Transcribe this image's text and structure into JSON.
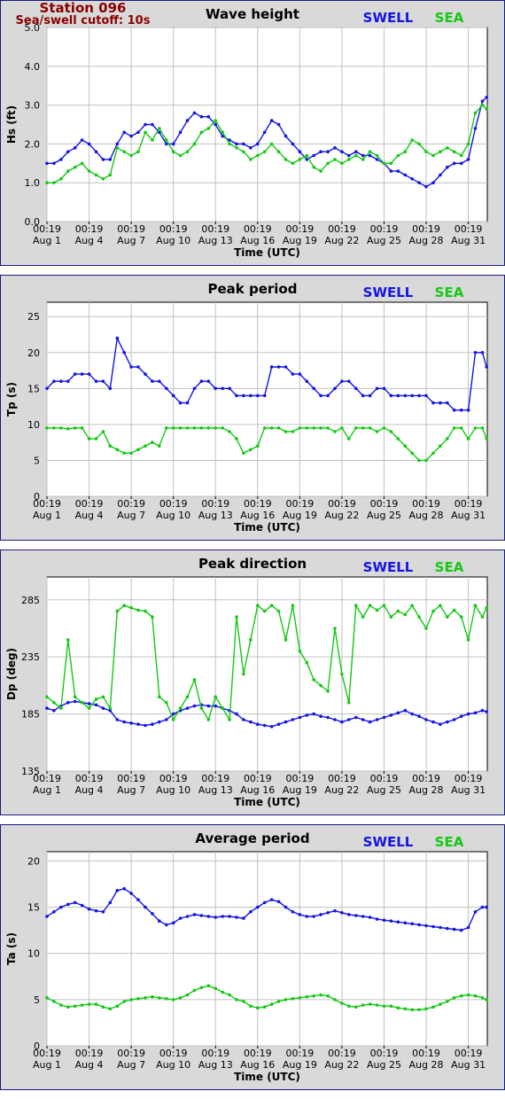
{
  "header": {
    "station": "Station 096",
    "cutoff": "Sea/swell cutoff: 10s"
  },
  "colors": {
    "swell": "#1414e6",
    "sea": "#14c814",
    "frame": "#1a1a80",
    "panel_bg": "#d9d9d9",
    "grid": "#c0c0c0"
  },
  "legend": {
    "swell": "SWELL",
    "sea": "SEA"
  },
  "x_axis": {
    "label": "Time (UTC)",
    "ticks": [
      {
        "day": 1,
        "time": "00:19",
        "date": "Aug 1"
      },
      {
        "day": 4,
        "time": "00:19",
        "date": "Aug 4"
      },
      {
        "day": 7,
        "time": "00:19",
        "date": "Aug 7"
      },
      {
        "day": 10,
        "time": "00:19",
        "date": "Aug 10"
      },
      {
        "day": 13,
        "time": "00:19",
        "date": "Aug 13"
      },
      {
        "day": 16,
        "time": "00:19",
        "date": "Aug 16"
      },
      {
        "day": 19,
        "time": "00:19",
        "date": "Aug 19"
      },
      {
        "day": 22,
        "time": "00:19",
        "date": "Aug 22"
      },
      {
        "day": 25,
        "time": "00:19",
        "date": "Aug 25"
      },
      {
        "day": 28,
        "time": "00:19",
        "date": "Aug 28"
      },
      {
        "day": 31,
        "time": "00:19",
        "date": "Aug 31"
      }
    ],
    "xlim": [
      1,
      32.35
    ]
  },
  "chart_data": [
    {
      "type": "line",
      "title": "Wave height",
      "ylabel": "Hs (ft)",
      "ylim": [
        0,
        5
      ],
      "yticks": [
        "0.0",
        "1.0",
        "2.0",
        "3.0",
        "4.0",
        "5.0"
      ],
      "grid": true,
      "legend": "top-right",
      "x": [
        1,
        1.5,
        2,
        2.5,
        3,
        3.5,
        4,
        4.5,
        5,
        5.5,
        6,
        6.5,
        7,
        7.5,
        8,
        8.5,
        9,
        9.5,
        10,
        10.5,
        11,
        11.5,
        12,
        12.5,
        13,
        13.5,
        14,
        14.5,
        15,
        15.5,
        16,
        16.5,
        17,
        17.5,
        18,
        18.5,
        19,
        19.5,
        20,
        20.5,
        21,
        21.5,
        22,
        22.5,
        23,
        23.5,
        24,
        24.5,
        25,
        25.5,
        26,
        26.5,
        27,
        27.5,
        28,
        28.5,
        29,
        29.5,
        30,
        30.5,
        31,
        31.5,
        32,
        32.3
      ],
      "series": [
        {
          "name": "SWELL",
          "values": [
            1.5,
            1.5,
            1.6,
            1.8,
            1.9,
            2.1,
            2.0,
            1.8,
            1.6,
            1.6,
            2.0,
            2.3,
            2.2,
            2.3,
            2.5,
            2.5,
            2.3,
            2.0,
            2.0,
            2.3,
            2.6,
            2.8,
            2.7,
            2.7,
            2.5,
            2.2,
            2.1,
            2.0,
            2.0,
            1.9,
            2.0,
            2.3,
            2.6,
            2.5,
            2.2,
            2.0,
            1.8,
            1.6,
            1.7,
            1.8,
            1.8,
            1.9,
            1.8,
            1.7,
            1.8,
            1.7,
            1.7,
            1.6,
            1.5,
            1.3,
            1.3,
            1.2,
            1.1,
            1.0,
            0.9,
            1.0,
            1.2,
            1.4,
            1.5,
            1.5,
            1.6,
            2.4,
            3.1,
            3.2
          ]
        },
        {
          "name": "SEA",
          "values": [
            1.0,
            1.0,
            1.1,
            1.3,
            1.4,
            1.5,
            1.3,
            1.2,
            1.1,
            1.2,
            1.9,
            1.8,
            1.7,
            1.8,
            2.3,
            2.1,
            2.4,
            2.1,
            1.8,
            1.7,
            1.8,
            2.0,
            2.3,
            2.4,
            2.6,
            2.3,
            2.0,
            1.9,
            1.8,
            1.6,
            1.7,
            1.8,
            2.0,
            1.8,
            1.6,
            1.5,
            1.6,
            1.7,
            1.4,
            1.3,
            1.5,
            1.6,
            1.5,
            1.6,
            1.7,
            1.6,
            1.8,
            1.7,
            1.5,
            1.5,
            1.7,
            1.8,
            2.1,
            2.0,
            1.8,
            1.7,
            1.8,
            1.9,
            1.8,
            1.7,
            2.0,
            2.8,
            3.0,
            2.9
          ]
        }
      ]
    },
    {
      "type": "line",
      "title": "Peak period",
      "ylabel": "Tp (s)",
      "ylim": [
        0,
        27
      ],
      "yticks": [
        "0",
        "5",
        "10",
        "15",
        "20",
        "25"
      ],
      "grid": true,
      "legend": "top-right",
      "x": [
        1,
        1.5,
        2,
        2.5,
        3,
        3.5,
        4,
        4.5,
        5,
        5.5,
        6,
        6.5,
        7,
        7.5,
        8,
        8.5,
        9,
        9.5,
        10,
        10.5,
        11,
        11.5,
        12,
        12.5,
        13,
        13.5,
        14,
        14.5,
        15,
        15.5,
        16,
        16.5,
        17,
        17.5,
        18,
        18.5,
        19,
        19.5,
        20,
        20.5,
        21,
        21.5,
        22,
        22.5,
        23,
        23.5,
        24,
        24.5,
        25,
        25.5,
        26,
        26.5,
        27,
        27.5,
        28,
        28.5,
        29,
        29.5,
        30,
        30.5,
        31,
        31.5,
        32,
        32.3
      ],
      "series": [
        {
          "name": "SWELL",
          "values": [
            15,
            16,
            16,
            16,
            17,
            17,
            17,
            16,
            16,
            15,
            22,
            20,
            18,
            18,
            17,
            16,
            16,
            15,
            14,
            13,
            13,
            15,
            16,
            16,
            15,
            15,
            15,
            14,
            14,
            14,
            14,
            14,
            18,
            18,
            18,
            17,
            17,
            16,
            15,
            14,
            14,
            15,
            16,
            16,
            15,
            14,
            14,
            15,
            15,
            14,
            14,
            14,
            14,
            14,
            14,
            13,
            13,
            13,
            12,
            12,
            12,
            20,
            20,
            18
          ]
        },
        {
          "name": "SEA",
          "values": [
            9.5,
            9.5,
            9.5,
            9.4,
            9.5,
            9.5,
            8,
            8,
            9,
            7,
            6.5,
            6,
            6,
            6.5,
            7,
            7.5,
            7,
            9.5,
            9.5,
            9.5,
            9.5,
            9.5,
            9.5,
            9.5,
            9.5,
            9.5,
            9,
            8,
            6,
            6.5,
            7,
            9.5,
            9.5,
            9.5,
            9,
            9,
            9.5,
            9.5,
            9.5,
            9.5,
            9.5,
            9,
            9.5,
            8,
            9.5,
            9.5,
            9.5,
            9,
            9.5,
            9,
            8,
            7,
            6,
            5,
            5,
            6,
            7,
            8,
            9.5,
            9.5,
            8,
            9.5,
            9.5,
            8
          ]
        }
      ]
    },
    {
      "type": "line",
      "title": "Peak direction",
      "ylabel": "Dp (deg)",
      "ylim": [
        135,
        305
      ],
      "yticks": [
        "135",
        "185",
        "235",
        "285"
      ],
      "grid": true,
      "legend": "top-right",
      "x": [
        1,
        1.5,
        2,
        2.5,
        3,
        3.5,
        4,
        4.5,
        5,
        5.5,
        6,
        6.5,
        7,
        7.5,
        8,
        8.5,
        9,
        9.5,
        10,
        10.5,
        11,
        11.5,
        12,
        12.5,
        13,
        13.5,
        14,
        14.5,
        15,
        15.5,
        16,
        16.5,
        17,
        17.5,
        18,
        18.5,
        19,
        19.5,
        20,
        20.5,
        21,
        21.5,
        22,
        22.5,
        23,
        23.5,
        24,
        24.5,
        25,
        25.5,
        26,
        26.5,
        27,
        27.5,
        28,
        28.5,
        29,
        29.5,
        30,
        30.5,
        31,
        31.5,
        32,
        32.3
      ],
      "series": [
        {
          "name": "SWELL",
          "values": [
            190,
            188,
            192,
            195,
            196,
            195,
            194,
            193,
            190,
            188,
            180,
            178,
            177,
            176,
            175,
            176,
            178,
            180,
            185,
            188,
            190,
            192,
            193,
            192,
            192,
            190,
            188,
            185,
            180,
            178,
            176,
            175,
            174,
            176,
            178,
            180,
            182,
            184,
            185,
            183,
            182,
            180,
            178,
            180,
            182,
            180,
            178,
            180,
            182,
            184,
            186,
            188,
            185,
            183,
            180,
            178,
            176,
            178,
            180,
            183,
            185,
            186,
            188,
            187
          ]
        },
        {
          "name": "SEA",
          "values": [
            200,
            195,
            190,
            250,
            200,
            195,
            190,
            198,
            200,
            190,
            275,
            280,
            278,
            276,
            275,
            270,
            200,
            195,
            180,
            190,
            200,
            215,
            190,
            180,
            200,
            190,
            180,
            270,
            220,
            250,
            280,
            275,
            280,
            275,
            250,
            280,
            240,
            230,
            215,
            210,
            205,
            260,
            220,
            195,
            280,
            270,
            280,
            276,
            280,
            270,
            275,
            272,
            280,
            270,
            260,
            275,
            280,
            270,
            276,
            270,
            250,
            280,
            270,
            278
          ]
        }
      ]
    },
    {
      "type": "line",
      "title": "Average period",
      "ylabel": "Ta (s)",
      "ylim": [
        0,
        21
      ],
      "yticks": [
        "0",
        "5",
        "10",
        "15",
        "20"
      ],
      "grid": true,
      "legend": "top-right",
      "x": [
        1,
        1.5,
        2,
        2.5,
        3,
        3.5,
        4,
        4.5,
        5,
        5.5,
        6,
        6.5,
        7,
        7.5,
        8,
        8.5,
        9,
        9.5,
        10,
        10.5,
        11,
        11.5,
        12,
        12.5,
        13,
        13.5,
        14,
        14.5,
        15,
        15.5,
        16,
        16.5,
        17,
        17.5,
        18,
        18.5,
        19,
        19.5,
        20,
        20.5,
        21,
        21.5,
        22,
        22.5,
        23,
        23.5,
        24,
        24.5,
        25,
        25.5,
        26,
        26.5,
        27,
        27.5,
        28,
        28.5,
        29,
        29.5,
        30,
        30.5,
        31,
        31.5,
        32,
        32.3
      ],
      "series": [
        {
          "name": "SWELL",
          "values": [
            14,
            14.5,
            15,
            15.3,
            15.5,
            15.2,
            14.8,
            14.6,
            14.5,
            15.5,
            16.8,
            17,
            16.5,
            15.8,
            15,
            14.3,
            13.5,
            13.1,
            13.3,
            13.8,
            14,
            14.2,
            14.1,
            14,
            13.9,
            14,
            14,
            13.9,
            13.8,
            14.5,
            15,
            15.5,
            15.8,
            15.6,
            15,
            14.5,
            14.2,
            14,
            14,
            14.2,
            14.4,
            14.6,
            14.4,
            14.2,
            14.1,
            14,
            13.9,
            13.7,
            13.6,
            13.5,
            13.4,
            13.3,
            13.2,
            13.1,
            13,
            12.9,
            12.8,
            12.7,
            12.6,
            12.5,
            12.8,
            14.5,
            15,
            15
          ]
        },
        {
          "name": "SEA",
          "values": [
            5.2,
            4.8,
            4.4,
            4.2,
            4.3,
            4.4,
            4.5,
            4.5,
            4.2,
            4.0,
            4.3,
            4.8,
            5.0,
            5.1,
            5.2,
            5.3,
            5.2,
            5.1,
            5.0,
            5.2,
            5.5,
            6.0,
            6.3,
            6.5,
            6.2,
            5.8,
            5.5,
            5.0,
            4.8,
            4.3,
            4.1,
            4.2,
            4.5,
            4.8,
            5.0,
            5.1,
            5.2,
            5.3,
            5.4,
            5.5,
            5.4,
            5.0,
            4.6,
            4.3,
            4.2,
            4.4,
            4.5,
            4.4,
            4.3,
            4.3,
            4.1,
            4.0,
            3.9,
            3.9,
            4.0,
            4.2,
            4.5,
            4.8,
            5.2,
            5.4,
            5.5,
            5.4,
            5.2,
            5.0
          ]
        }
      ]
    }
  ]
}
